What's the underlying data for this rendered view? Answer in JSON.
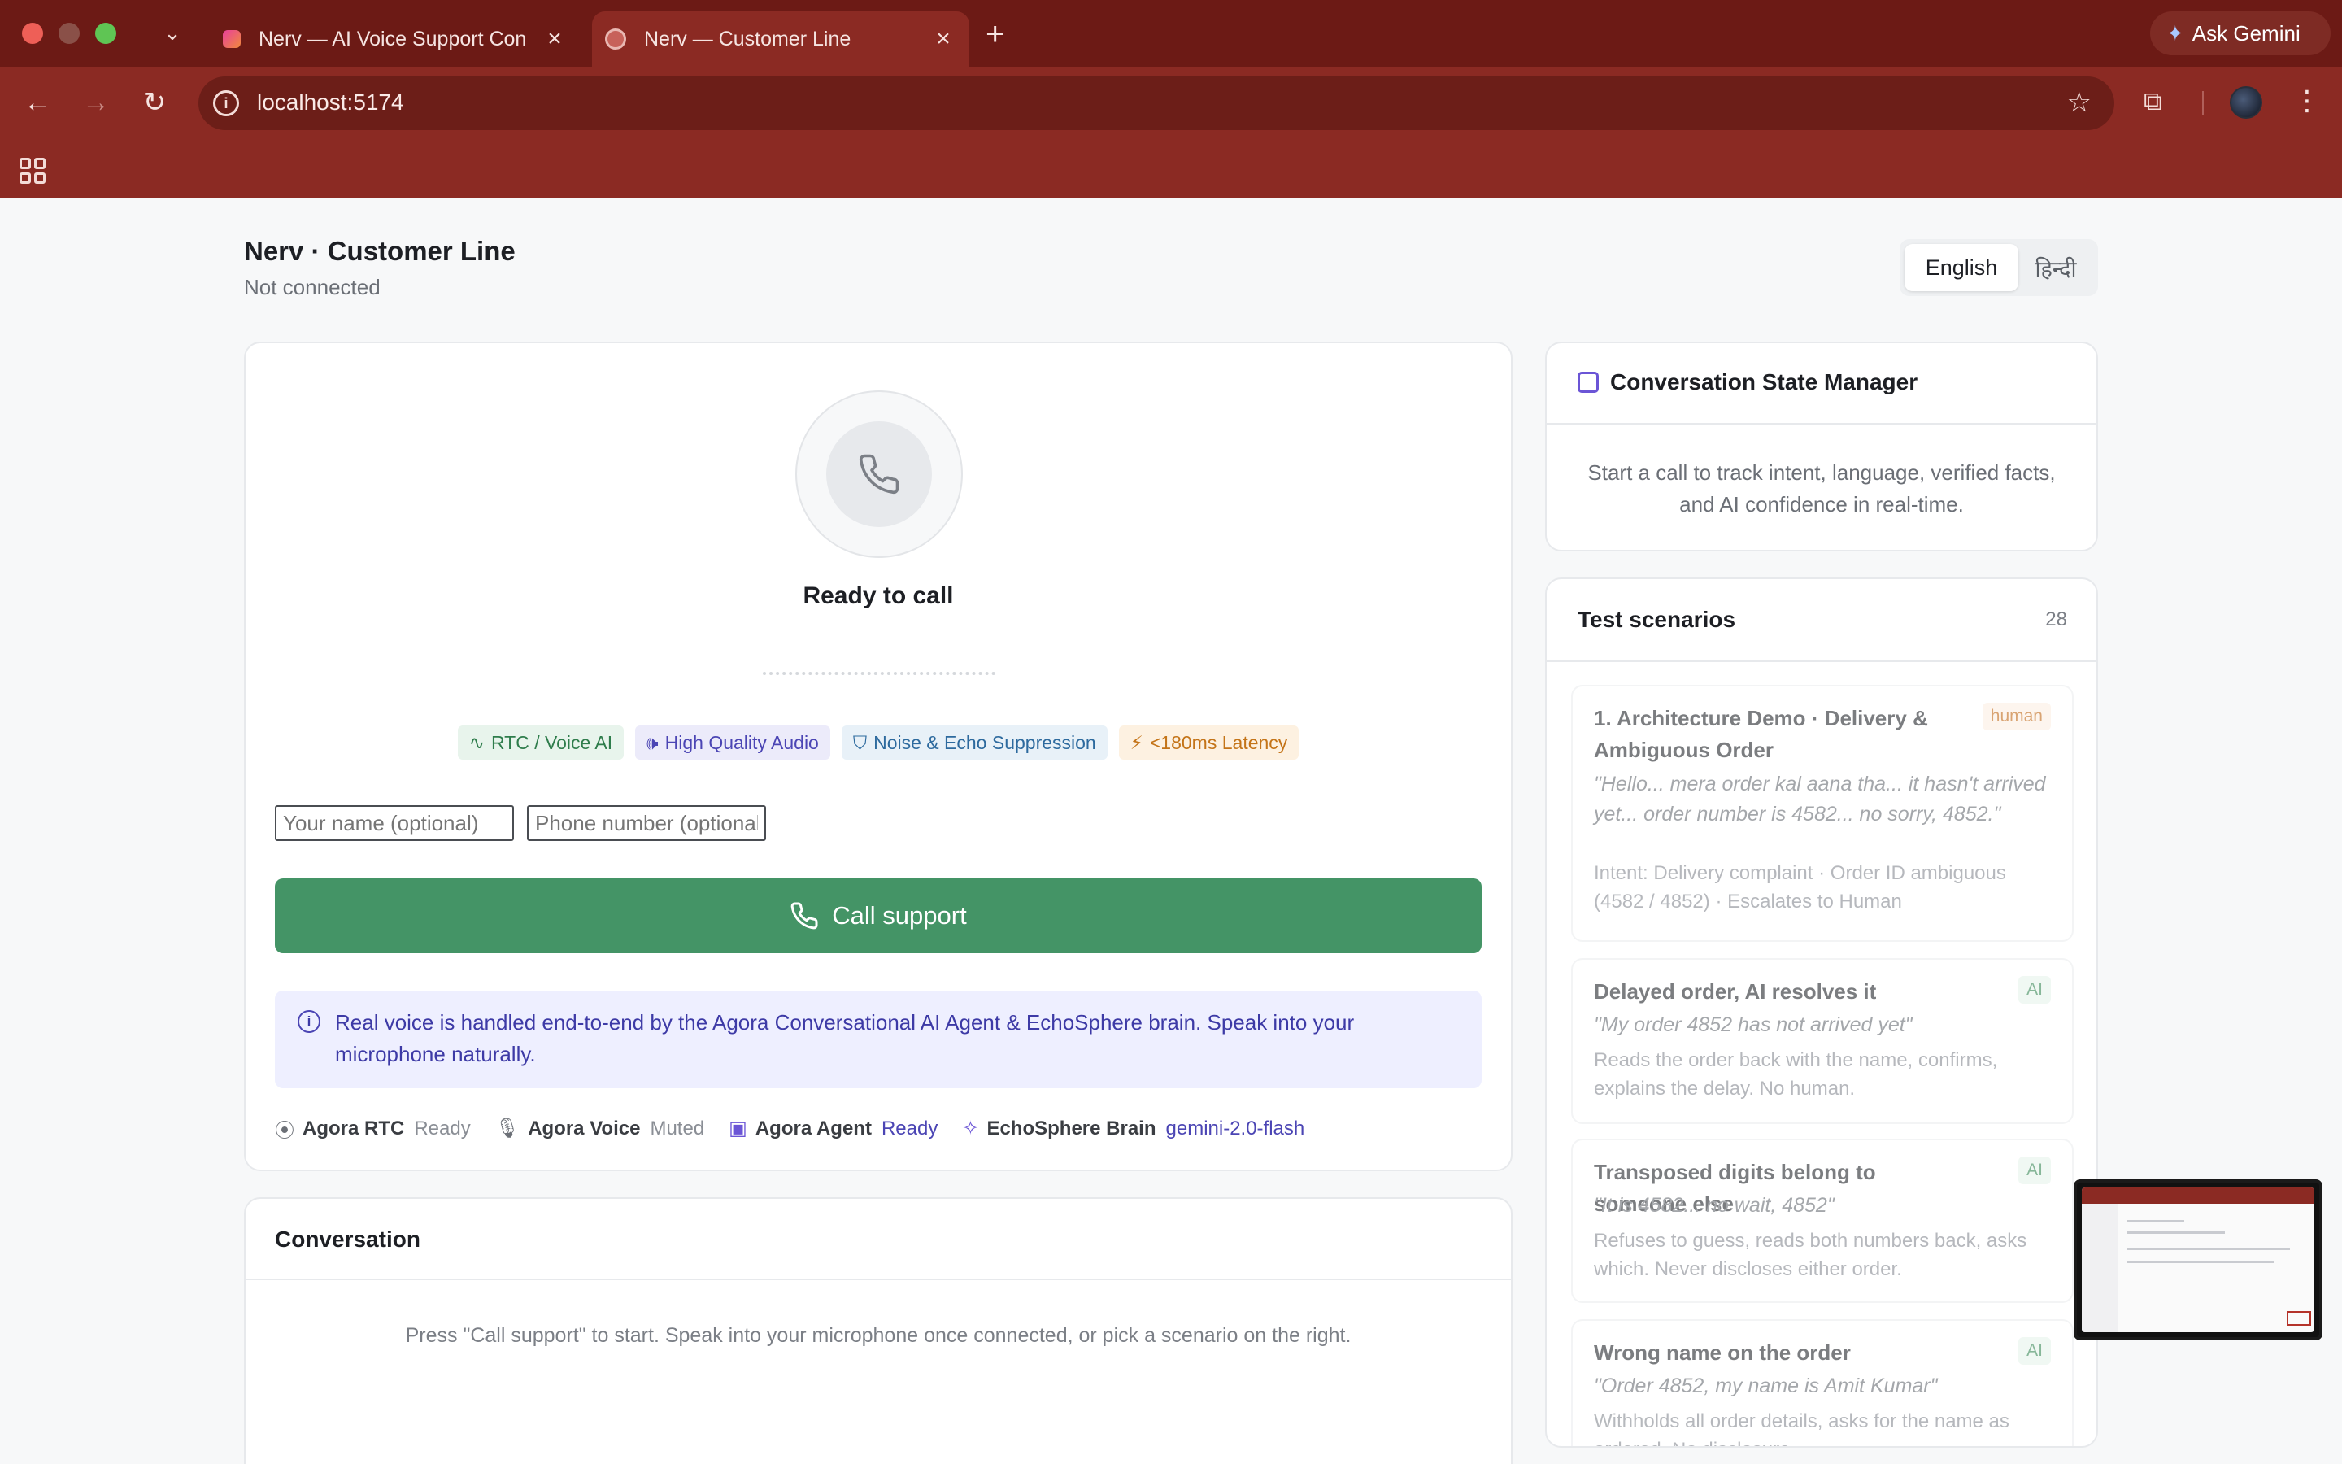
{
  "browser": {
    "tabs": [
      {
        "title": "Nerv — AI Voice Support Con",
        "active": false
      },
      {
        "title": "Nerv — Customer Line",
        "active": true
      }
    ],
    "new_tab": "+",
    "gemini_label": "Ask Gemini",
    "url": "localhost:5174",
    "colors": {
      "tabstrip": "#6c1a15",
      "toolbar": "#8b2a23"
    }
  },
  "header": {
    "title": "Nerv · Customer Line",
    "status": "Not connected",
    "languages": [
      "English",
      "हिन्दी"
    ],
    "active_language": "English"
  },
  "call": {
    "state": "Ready to call",
    "badges": [
      {
        "icon": "activity-icon",
        "label": "RTC / Voice AI"
      },
      {
        "icon": "speaker-icon",
        "label": "High Quality Audio"
      },
      {
        "icon": "shield-icon",
        "label": "Noise & Echo Suppression"
      },
      {
        "icon": "bolt-icon",
        "label": "<180ms Latency"
      }
    ],
    "name_placeholder": "Your name (optional)",
    "phone_placeholder": "Phone number (optional)",
    "button_label": "Call support",
    "button_color": "#449466",
    "info": "Real voice is handled end-to-end by the Agora Conversational AI Agent & EchoSphere brain. Speak into your microphone naturally.",
    "services": [
      {
        "name": "Agora RTC",
        "value": "Ready"
      },
      {
        "name": "Agora Voice",
        "value": "Muted"
      },
      {
        "name": "Agora Agent",
        "value": "Ready"
      },
      {
        "name": "EchoSphere Brain",
        "value": "gemini-2.0-flash"
      }
    ]
  },
  "conversation": {
    "title": "Conversation",
    "empty": "Press \"Call support\" to start. Speak into your microphone once connected, or pick a scenario on the right."
  },
  "state_manager": {
    "title": "Conversation State Manager",
    "text": "Start a call to track intent, language, verified facts, and AI confidence in real-time."
  },
  "scenarios": {
    "title": "Test scenarios",
    "count": "28",
    "items": [
      {
        "title": "1. Architecture Demo · Delivery & Ambiguous Order",
        "tag": "human",
        "quote": "\"Hello... mera order kal aana tha... it hasn't arrived yet... order number is 4582... no sorry, 4852.\"",
        "desc": "Intent: Delivery complaint · Order ID ambiguous (4582 / 4852) · Escalates to Human"
      },
      {
        "title": "Delayed order, AI resolves it",
        "tag": "AI",
        "quote": "\"My order 4852 has not arrived yet\"",
        "desc": "Reads the order back with the name, confirms, explains the delay. No human."
      },
      {
        "title": "Transposed digits belong to someone else",
        "tag": "AI",
        "quote": "\"It is 4582... no wait, 4852\"",
        "desc": "Refuses to guess, reads both numbers back, asks which. Never discloses either order."
      },
      {
        "title": "Wrong name on the order",
        "tag": "AI",
        "quote": "\"Order 4852, my name is Amit Kumar\"",
        "desc": "Withholds all order details, asks for the name as ordered. No disclosure."
      }
    ]
  }
}
